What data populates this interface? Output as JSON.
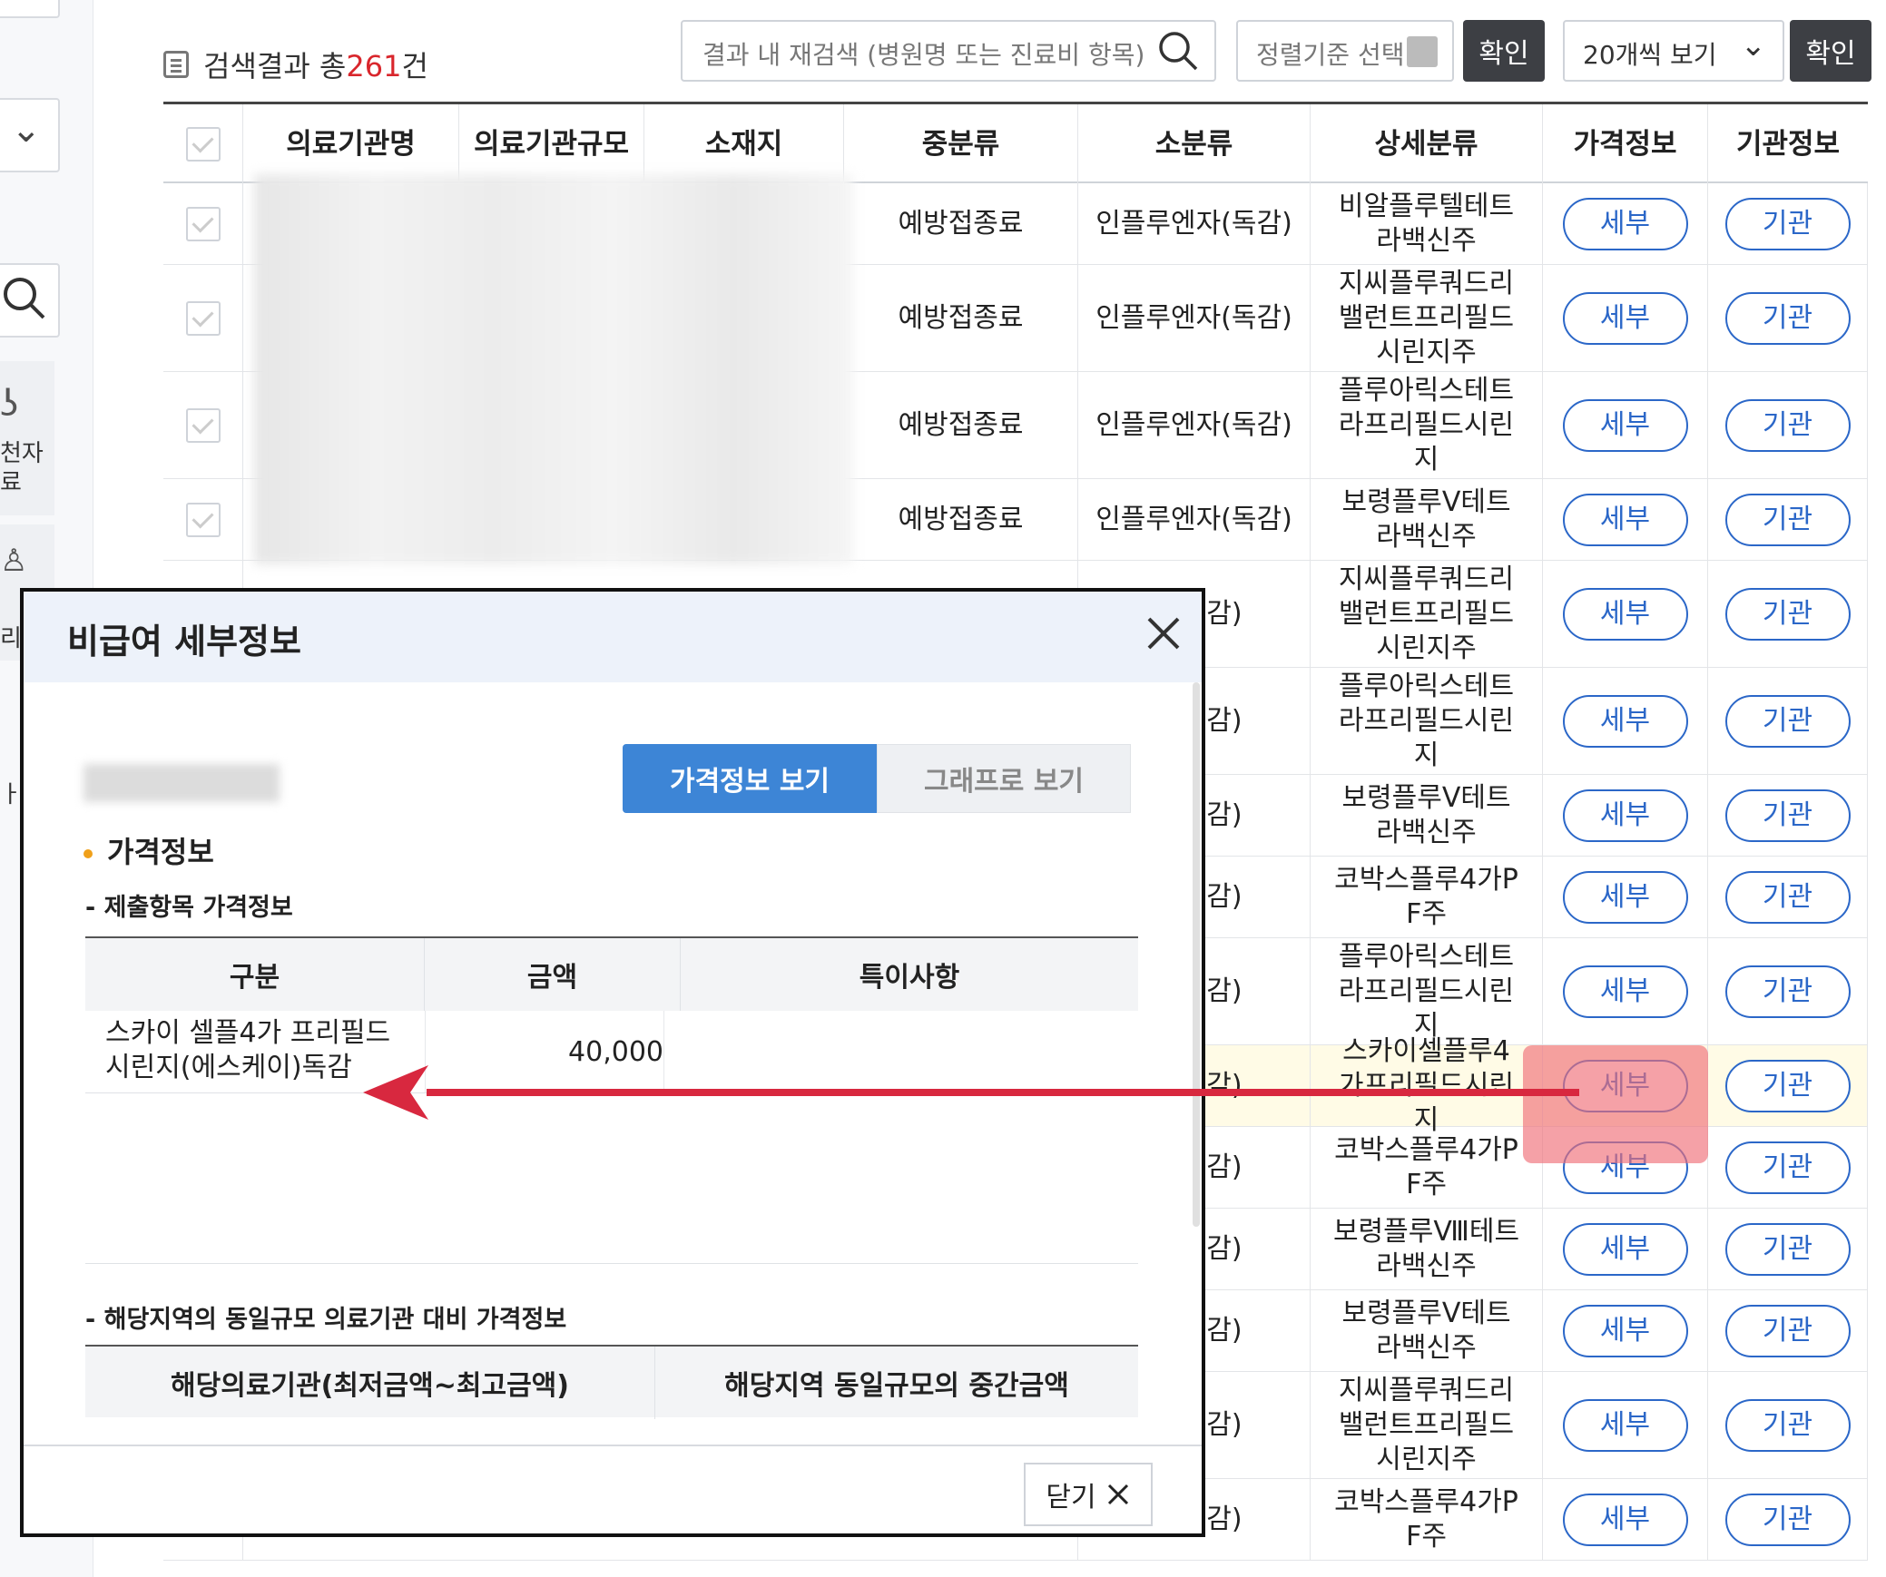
{
  "toolbar": {
    "title_prefix": "검색결과 총",
    "count": "261",
    "title_suffix": "건",
    "search_placeholder": "결과 내 재검색 (병원명 또는 진료비 항목)",
    "sort_label": "정렬기준 선택",
    "confirm_label": "확인",
    "page_size_label": "20개씩 보기",
    "confirm2_label": "확인"
  },
  "sidebar": {
    "label1": "천자",
    "label2": "료",
    "label3": "리",
    "label4": "ㅏ"
  },
  "table": {
    "headers": [
      "의료기관명",
      "의료기관규모",
      "소재지",
      "중분류",
      "소분류",
      "상세분류",
      "가격정보",
      "기관정보"
    ],
    "price_button": "세부",
    "org_button": "기관",
    "rows": [
      {
        "mid": "예방접종료",
        "small": "인플루엔자(독감)",
        "detail": "비알플루텔테트라백신주"
      },
      {
        "mid": "예방접종료",
        "small": "인플루엔자(독감)",
        "detail": "지씨플루쿼드리밸런트프리필드시린지주"
      },
      {
        "mid": "예방접종료",
        "small": "인플루엔자(독감)",
        "detail": "플루아릭스테트라프리필드시린지"
      },
      {
        "mid": "예방접종료",
        "small": "인플루엔자(독감)",
        "detail": "보령플루V테트라백신주"
      },
      {
        "mid": "",
        "small": "다(독감)",
        "detail": "지씨플루쿼드리밸런트프리필드시린지주"
      },
      {
        "mid": "",
        "small": "다(독감)",
        "detail": "플루아릭스테트라프리필드시린지"
      },
      {
        "mid": "",
        "small": "다(독감)",
        "detail": "보령플루V테트라백신주"
      },
      {
        "mid": "",
        "small": "다(독감)",
        "detail": "코박스플루4가PF주"
      },
      {
        "mid": "",
        "small": "다(독감)",
        "detail": "플루아릭스테트라프리필드시린지"
      },
      {
        "mid": "",
        "small": "다(독감)",
        "detail": "스카이셀플루4가프리필드시린지"
      },
      {
        "mid": "",
        "small": "다(독감)",
        "detail": "코박스플루4가PF주"
      },
      {
        "mid": "",
        "small": "다(독감)",
        "detail": "보령플루Ⅷ테트라백신주"
      },
      {
        "mid": "",
        "small": "다(독감)",
        "detail": "보령플루V테트라백신주"
      },
      {
        "mid": "",
        "small": "다(독감)",
        "detail": "지씨플루쿼드리밸런트프리필드시린지주"
      },
      {
        "mid": "",
        "small": "다(독감)",
        "detail": "코박스플루4가PF주"
      }
    ]
  },
  "modal": {
    "title": "비급여 세부정보",
    "tab_price": "가격정보 보기",
    "tab_graph": "그래프로 보기",
    "section_price": "가격정보",
    "sub1": "- 제출항목 가격정보",
    "col1": "구분",
    "col2": "금액",
    "col3": "특이사항",
    "item_name": "스카이 셀플4가 프리필드 시린지(에스케이)독감",
    "item_price": "40,000",
    "item_note": "",
    "sub2": "- 해당지역의 동일규모 의료기관 대비 가격정보",
    "col4": "해당의료기관(최저금액~최고금액)",
    "col5": "해당지역 동일규모의 중간금액",
    "close_label": "닫기"
  },
  "colors": {
    "accent": "#3d85d6",
    "pill": "#2b67c8",
    "count": "#d9262c",
    "arrow": "#d8283f"
  }
}
